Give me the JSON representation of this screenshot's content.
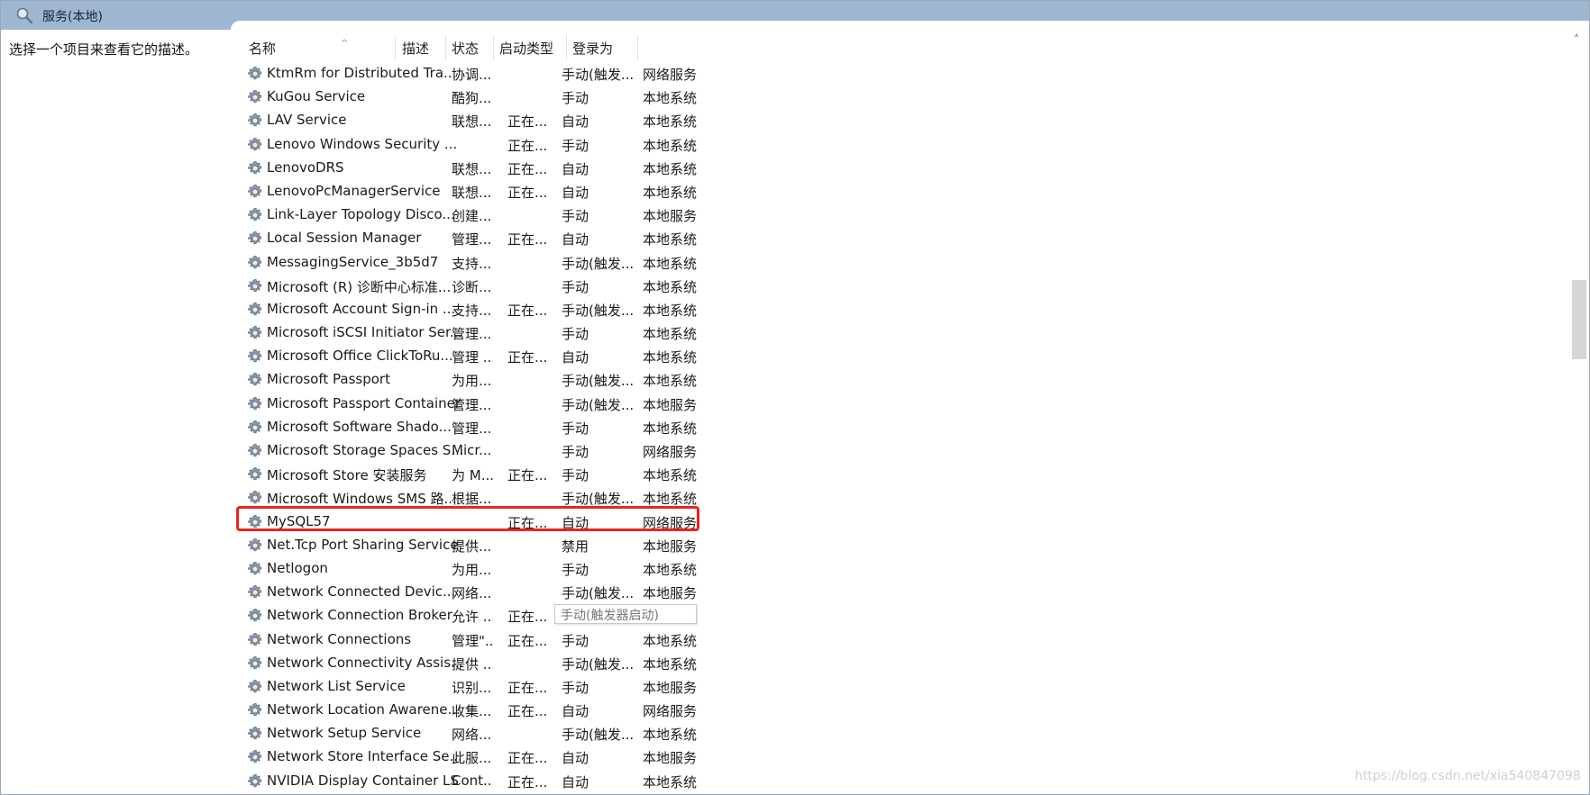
{
  "window": {
    "title": "服务(本地)"
  },
  "left_pane": {
    "description": "选择一个项目来查看它的描述。"
  },
  "columns": {
    "name": "名称",
    "desc": "描述",
    "status": "状态",
    "startup": "启动类型",
    "login": "登录为"
  },
  "rows": [
    {
      "name": "KtmRm for Distributed Tra...",
      "desc": "协调...",
      "status": "",
      "startup": "手动(触发...",
      "login": "网络服务"
    },
    {
      "name": "KuGou Service",
      "desc": "酷狗...",
      "status": "",
      "startup": "手动",
      "login": "本地系统"
    },
    {
      "name": "LAV Service",
      "desc": "联想...",
      "status": "正在...",
      "startup": "自动",
      "login": "本地系统"
    },
    {
      "name": "Lenovo Windows Security ...",
      "desc": "",
      "status": "正在...",
      "startup": "手动",
      "login": "本地系统"
    },
    {
      "name": "LenovoDRS",
      "desc": "联想...",
      "status": "正在...",
      "startup": "自动",
      "login": "本地系统"
    },
    {
      "name": "LenovoPcManagerService",
      "desc": "联想...",
      "status": "正在...",
      "startup": "自动",
      "login": "本地系统"
    },
    {
      "name": "Link-Layer Topology Disco...",
      "desc": "创建...",
      "status": "",
      "startup": "手动",
      "login": "本地服务"
    },
    {
      "name": "Local Session Manager",
      "desc": "管理...",
      "status": "正在...",
      "startup": "自动",
      "login": "本地系统"
    },
    {
      "name": "MessagingService_3b5d7",
      "desc": "支持...",
      "status": "",
      "startup": "手动(触发...",
      "login": "本地系统"
    },
    {
      "name": "Microsoft (R) 诊断中心标准...",
      "desc": "诊断...",
      "status": "",
      "startup": "手动",
      "login": "本地系统"
    },
    {
      "name": "Microsoft Account Sign-in ...",
      "desc": "支持...",
      "status": "正在...",
      "startup": "手动(触发...",
      "login": "本地系统"
    },
    {
      "name": "Microsoft iSCSI Initiator Ser...",
      "desc": "管理...",
      "status": "",
      "startup": "手动",
      "login": "本地系统"
    },
    {
      "name": "Microsoft Office ClickToRu...",
      "desc": "管理 ...",
      "status": "正在...",
      "startup": "自动",
      "login": "本地系统"
    },
    {
      "name": "Microsoft Passport",
      "desc": "为用...",
      "status": "",
      "startup": "手动(触发...",
      "login": "本地系统"
    },
    {
      "name": "Microsoft Passport Container",
      "desc": "管理...",
      "status": "",
      "startup": "手动(触发...",
      "login": "本地服务"
    },
    {
      "name": "Microsoft Software Shado...",
      "desc": "管理...",
      "status": "",
      "startup": "手动",
      "login": "本地系统"
    },
    {
      "name": "Microsoft Storage Spaces S...",
      "desc": "Micr...",
      "status": "",
      "startup": "手动",
      "login": "网络服务"
    },
    {
      "name": "Microsoft Store 安装服务",
      "desc": "为 M...",
      "status": "正在...",
      "startup": "手动",
      "login": "本地系统"
    },
    {
      "name": "Microsoft Windows SMS 路...",
      "desc": "根据...",
      "status": "",
      "startup": "手动(触发...",
      "login": "本地系统"
    },
    {
      "name": "MySQL57",
      "desc": "",
      "status": "正在...",
      "startup": "自动",
      "login": "网络服务"
    },
    {
      "name": "Net.Tcp Port Sharing Service",
      "desc": "提供...",
      "status": "",
      "startup": "禁用",
      "login": "本地服务"
    },
    {
      "name": "Netlogon",
      "desc": "为用...",
      "status": "",
      "startup": "手动",
      "login": "本地系统"
    },
    {
      "name": "Network Connected Devic...",
      "desc": "网络...",
      "status": "",
      "startup": "手动(触发...",
      "login": "本地服务"
    },
    {
      "name": "Network Connection Broker",
      "desc": "允许 ...",
      "status": "正在...",
      "startup": "",
      "login": "系统"
    },
    {
      "name": "Network Connections",
      "desc": "管理\"...",
      "status": "正在...",
      "startup": "手动",
      "login": "本地系统"
    },
    {
      "name": "Network Connectivity Assis...",
      "desc": "提供 ...",
      "status": "",
      "startup": "手动(触发...",
      "login": "本地系统"
    },
    {
      "name": "Network List Service",
      "desc": "识别...",
      "status": "正在...",
      "startup": "手动",
      "login": "本地服务"
    },
    {
      "name": "Network Location Awarene...",
      "desc": "收集...",
      "status": "正在...",
      "startup": "自动",
      "login": "网络服务"
    },
    {
      "name": "Network Setup Service",
      "desc": "网络...",
      "status": "",
      "startup": "手动(触发...",
      "login": "本地系统"
    },
    {
      "name": "Network Store Interface Se...",
      "desc": "此服...",
      "status": "正在...",
      "startup": "自动",
      "login": "本地服务"
    },
    {
      "name": "NVIDIA Display Container LS",
      "desc": "Cont...",
      "status": "正在...",
      "startup": "自动",
      "login": "本地系统"
    }
  ],
  "tooltip": "手动(触发器启动)",
  "watermark": "https://blog.csdn.net/xia540847098"
}
